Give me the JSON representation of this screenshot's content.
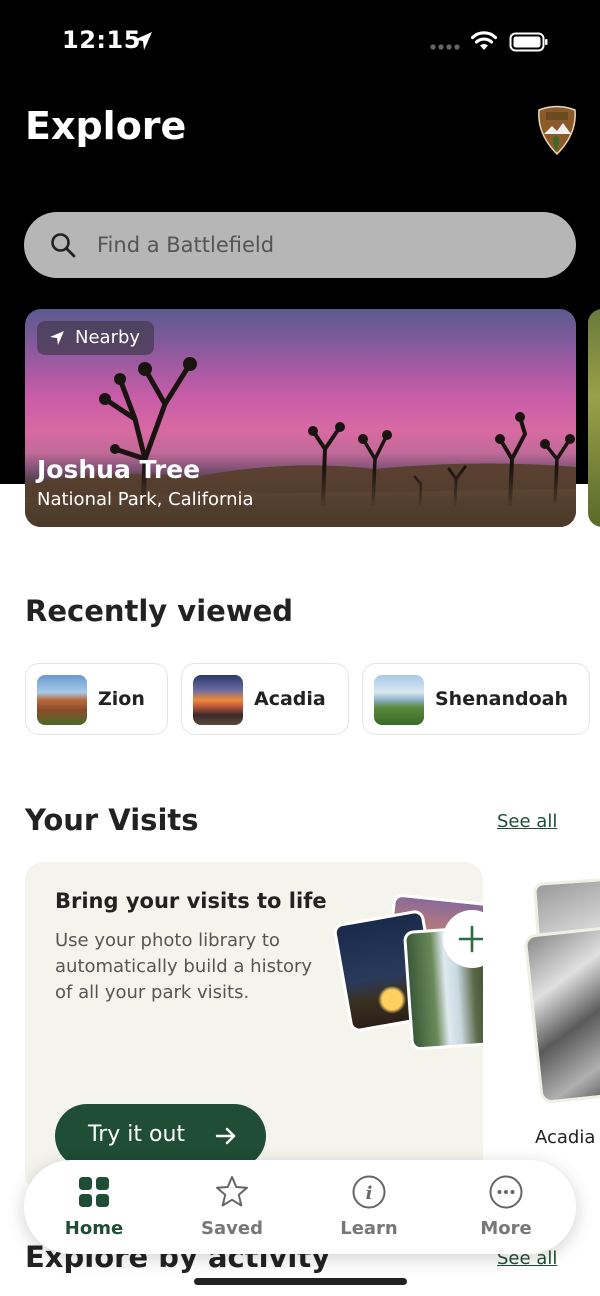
{
  "status_bar": {
    "time": "12:15"
  },
  "header": {
    "title": "Explore",
    "logo_icon": "nps-arrowhead-logo"
  },
  "search": {
    "placeholder": "Find a Battlefield"
  },
  "featured": {
    "badge": "Nearby",
    "title": "Joshua Tree",
    "subtitle": "National Park, California"
  },
  "recently_viewed": {
    "title": "Recently viewed",
    "items": [
      {
        "label": "Zion"
      },
      {
        "label": "Acadia"
      },
      {
        "label": "Shenandoah"
      }
    ]
  },
  "visits": {
    "title": "Your Visits",
    "see_all": "See all",
    "card": {
      "heading": "Bring your visits to life",
      "body": "Use your photo library to automatically build a history of all your park visits.",
      "button": "Try it out"
    },
    "next_card_label": "Acadia"
  },
  "explore_activity": {
    "title": "Explore by activity",
    "see_all": "See all"
  },
  "tab_bar": {
    "active": "Home",
    "tabs": [
      {
        "label": "Home",
        "icon": "grid-icon"
      },
      {
        "label": "Saved",
        "icon": "star-icon"
      },
      {
        "label": "Learn",
        "icon": "info-icon"
      },
      {
        "label": "More",
        "icon": "more-icon"
      }
    ]
  },
  "colors": {
    "brand_green": "#1f4d35",
    "search_bg": "#b6b6b6",
    "card_bg": "#f5f4ec"
  }
}
